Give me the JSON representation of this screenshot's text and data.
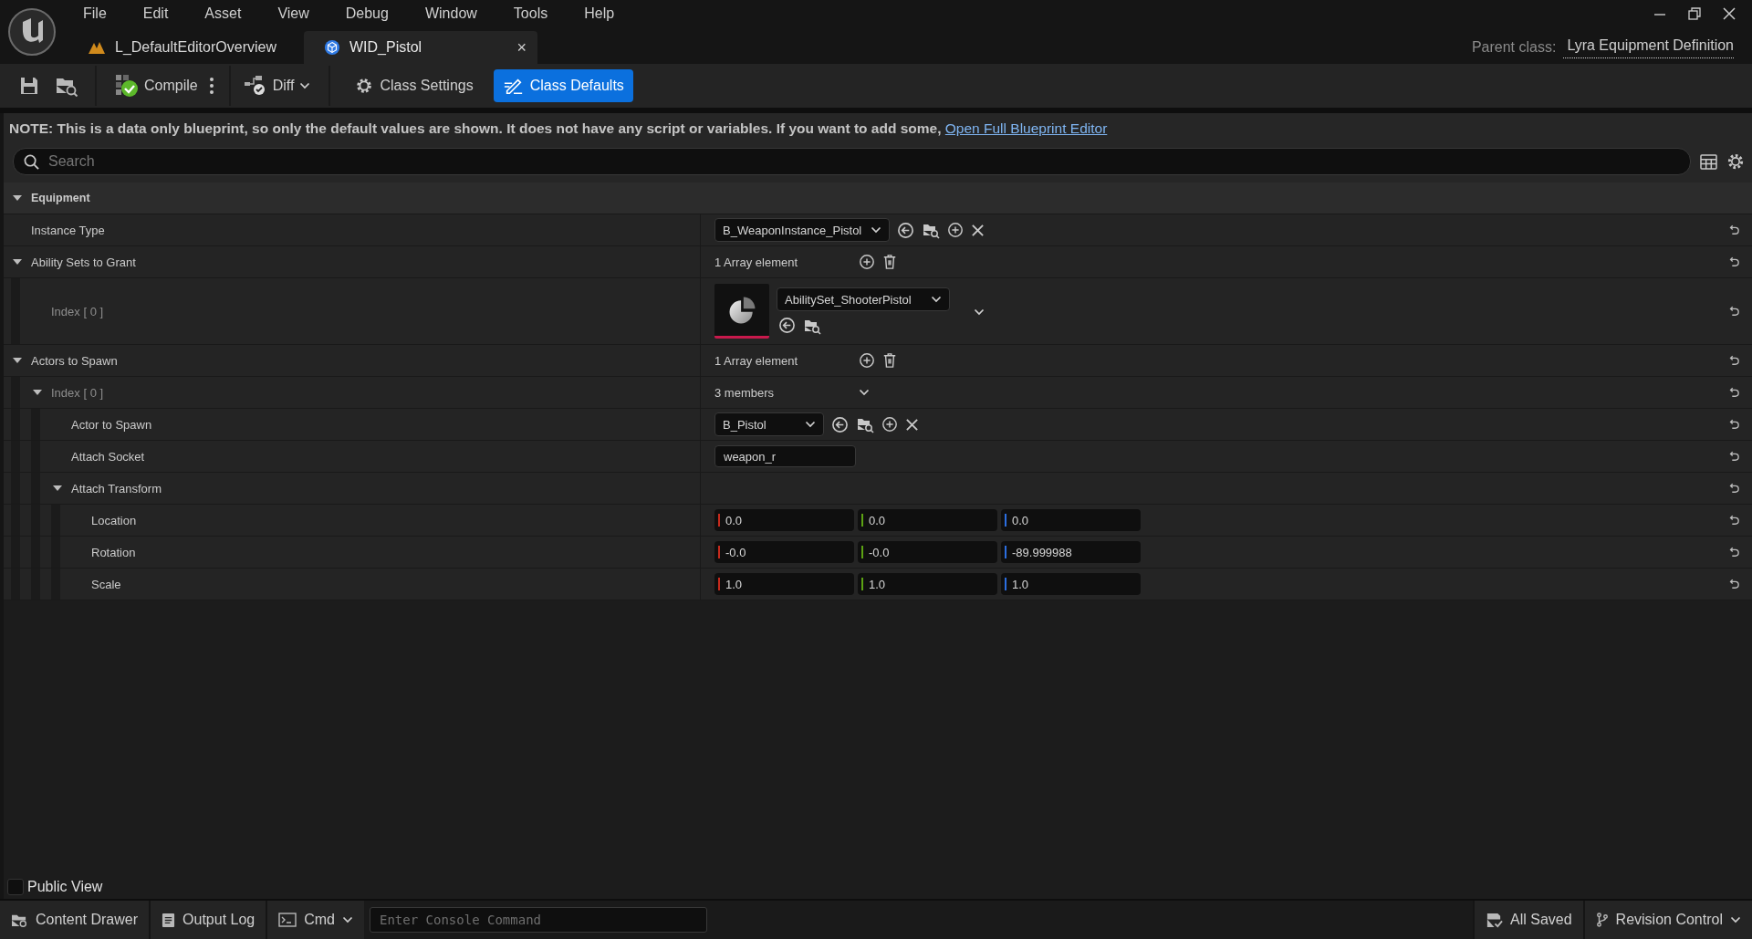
{
  "title_bar": {
    "menu": [
      "File",
      "Edit",
      "Asset",
      "View",
      "Debug",
      "Window",
      "Tools",
      "Help"
    ],
    "tabs": [
      {
        "label": "L_DefaultEditorOverview",
        "kind": "level",
        "selected": false
      },
      {
        "label": "WID_Pistol",
        "kind": "blueprint",
        "selected": true,
        "close": "×"
      }
    ],
    "parent_class": {
      "label": "Parent class:",
      "value": "Lyra Equipment Definition"
    }
  },
  "toolbar": {
    "compile": "Compile",
    "diff": "Diff",
    "modes": [
      {
        "label": "Class Settings",
        "kind": "settings",
        "selected": false
      },
      {
        "label": "Class Defaults",
        "kind": "defaults",
        "selected": true
      }
    ]
  },
  "note": {
    "text": "NOTE: This is a data only blueprint, so only the default values are shown.  It does not have any script or variables.  If you want to add some,",
    "link": "Open Full Blueprint Editor"
  },
  "search": {
    "placeholder": "Search"
  },
  "categories": [
    {
      "label": "Equipment",
      "expanded": true,
      "children": [
        {
          "label": "Instance Type",
          "kind": "class",
          "value": "B_WeaponInstance_Pistol"
        },
        {
          "label": "Ability Sets to Grant",
          "kind": "array",
          "value": "1 Array element",
          "expanded": true,
          "children": [
            {
              "label": "Index [ 0 ]",
              "kind": "asset",
              "value": "AbilitySet_ShooterPistol"
            }
          ]
        },
        {
          "label": "Actors to Spawn",
          "kind": "array",
          "value": "1 Array element",
          "expanded": true,
          "children": [
            {
              "label": "Index [ 0 ]",
              "kind": "struct",
              "value": "3 members",
              "expanded": true,
              "children": [
                {
                  "label": "Actor to Spawn",
                  "kind": "class",
                  "value": "B_Pistol"
                },
                {
                  "label": "Attach Socket",
                  "kind": "text",
                  "value": "weapon_r"
                },
                {
                  "label": "Attach Transform",
                  "kind": "group",
                  "expanded": true,
                  "children": [
                    {
                      "label": "Location",
                      "kind": "vector",
                      "components": [
                        {
                          "value": "0.0",
                          "color": "#c42a1c"
                        },
                        {
                          "value": "0.0",
                          "color": "#5ca213"
                        },
                        {
                          "value": "0.0",
                          "color": "#2b6ee0"
                        }
                      ]
                    },
                    {
                      "label": "Rotation",
                      "kind": "vector",
                      "components": [
                        {
                          "value": "-0.0",
                          "color": "#c42a1c"
                        },
                        {
                          "value": "-0.0",
                          "color": "#5ca213"
                        },
                        {
                          "value": "-89.999988",
                          "color": "#2b6ee0"
                        }
                      ]
                    },
                    {
                      "label": "Scale",
                      "kind": "vector",
                      "components": [
                        {
                          "value": "1.0",
                          "color": "#c42a1c"
                        },
                        {
                          "value": "1.0",
                          "color": "#5ca213"
                        },
                        {
                          "value": "1.0",
                          "color": "#2b6ee0"
                        }
                      ]
                    }
                  ]
                }
              ]
            }
          ]
        }
      ]
    }
  ],
  "public_view": {
    "label": "Public View",
    "checked": false
  },
  "status_bar": {
    "content_drawer": "Content Drawer",
    "output_log": "Output Log",
    "cmd": "Cmd",
    "console": {
      "placeholder": "Enter Console Command"
    },
    "saved": "All Saved",
    "revision_control": "Revision Control"
  }
}
